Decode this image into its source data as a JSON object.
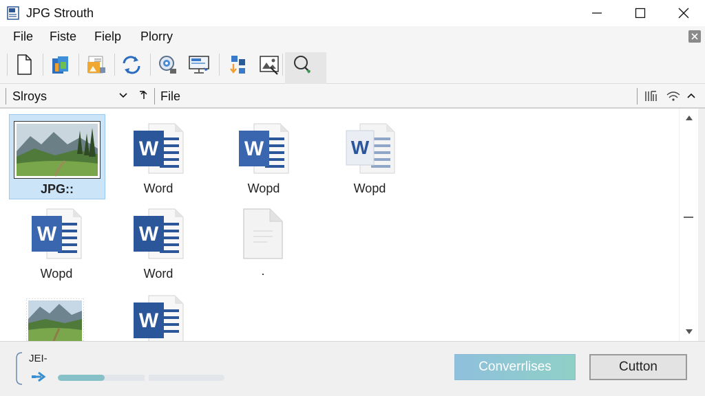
{
  "window": {
    "title": "JPG Strouth"
  },
  "menu": {
    "items": [
      "File",
      "Fiste",
      "Fielp",
      "Plorry"
    ]
  },
  "toolbar": {
    "buttons": [
      "new-document-icon",
      "copy-icon",
      "import-image-icon",
      "refresh-icon",
      "settings-icon",
      "monitor-icon",
      "split-icon",
      "image-edit-icon",
      "search-icon"
    ]
  },
  "address": {
    "location": "Slroys",
    "path": "File"
  },
  "items": [
    {
      "label": "JPG::",
      "type": "image",
      "selected": true
    },
    {
      "label": "Word",
      "type": "word"
    },
    {
      "label": "Wopd",
      "type": "word"
    },
    {
      "label": "Wopd",
      "type": "word-faded"
    },
    {
      "label": "Wopd",
      "type": "word"
    },
    {
      "label": "Word",
      "type": "word"
    },
    {
      "label": ".",
      "type": "blank"
    },
    {
      "label": "",
      "type": "image"
    },
    {
      "label": "",
      "type": "word"
    }
  ],
  "status": {
    "label": "JEI-",
    "progress_percent": 28
  },
  "actions": {
    "convert_label": "Converrlises",
    "cancel_label": "Cutton"
  },
  "colors": {
    "selection": "#cce4f7",
    "word_blue": "#2b579a",
    "accent": "#8fc0dd"
  }
}
